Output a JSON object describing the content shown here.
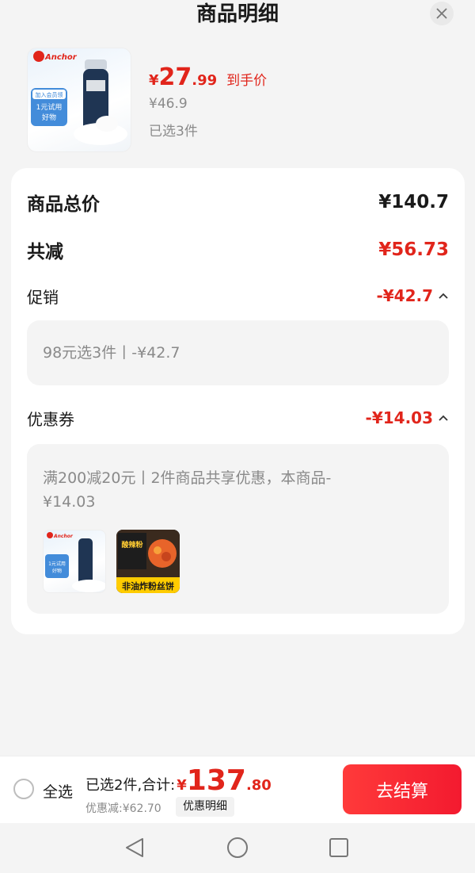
{
  "header": {
    "title": "商品明细"
  },
  "product": {
    "brand": "Anchor",
    "thumb_badge_top": "加入会员领",
    "thumb_badge_main": "1元试用好物",
    "price_yen": "¥",
    "price_int": "27",
    "price_dec": ".99",
    "price_tag": "到手价",
    "original_price": "¥46.9",
    "selected_count": "已选3件"
  },
  "summary": {
    "total_label": "商品总价",
    "total_value": "¥140.7",
    "discount_label": "共减",
    "discount_value": "¥56.73",
    "promo_label": "促销",
    "promo_value": "-¥42.7",
    "promo_detail": "98元选3件丨-¥42.7",
    "coupon_label": "优惠券",
    "coupon_value": "-¥14.03",
    "coupon_detail": "满200减20元丨2件商品共享优惠，本商品-¥14.03"
  },
  "coupon_items": [
    {
      "name": "Anchor",
      "badge": "1元试用好物"
    },
    {
      "name": "非油炸粉丝饼",
      "top_text": "酸辣粉"
    }
  ],
  "bottom": {
    "select_all": "全选",
    "sum_label": "已选2件,合计:",
    "sum_yen": "¥",
    "sum_int": "137",
    "sum_dec": ".80",
    "saved": "优惠减:¥62.70",
    "detail_button": "优惠明细",
    "checkout": "去结算"
  },
  "colors": {
    "accent": "#e1251b",
    "checkout": "#f31a2f"
  },
  "icons": [
    "close-icon",
    "chevron-up-icon",
    "back-triangle-icon",
    "home-circle-icon",
    "recent-square-icon"
  ]
}
